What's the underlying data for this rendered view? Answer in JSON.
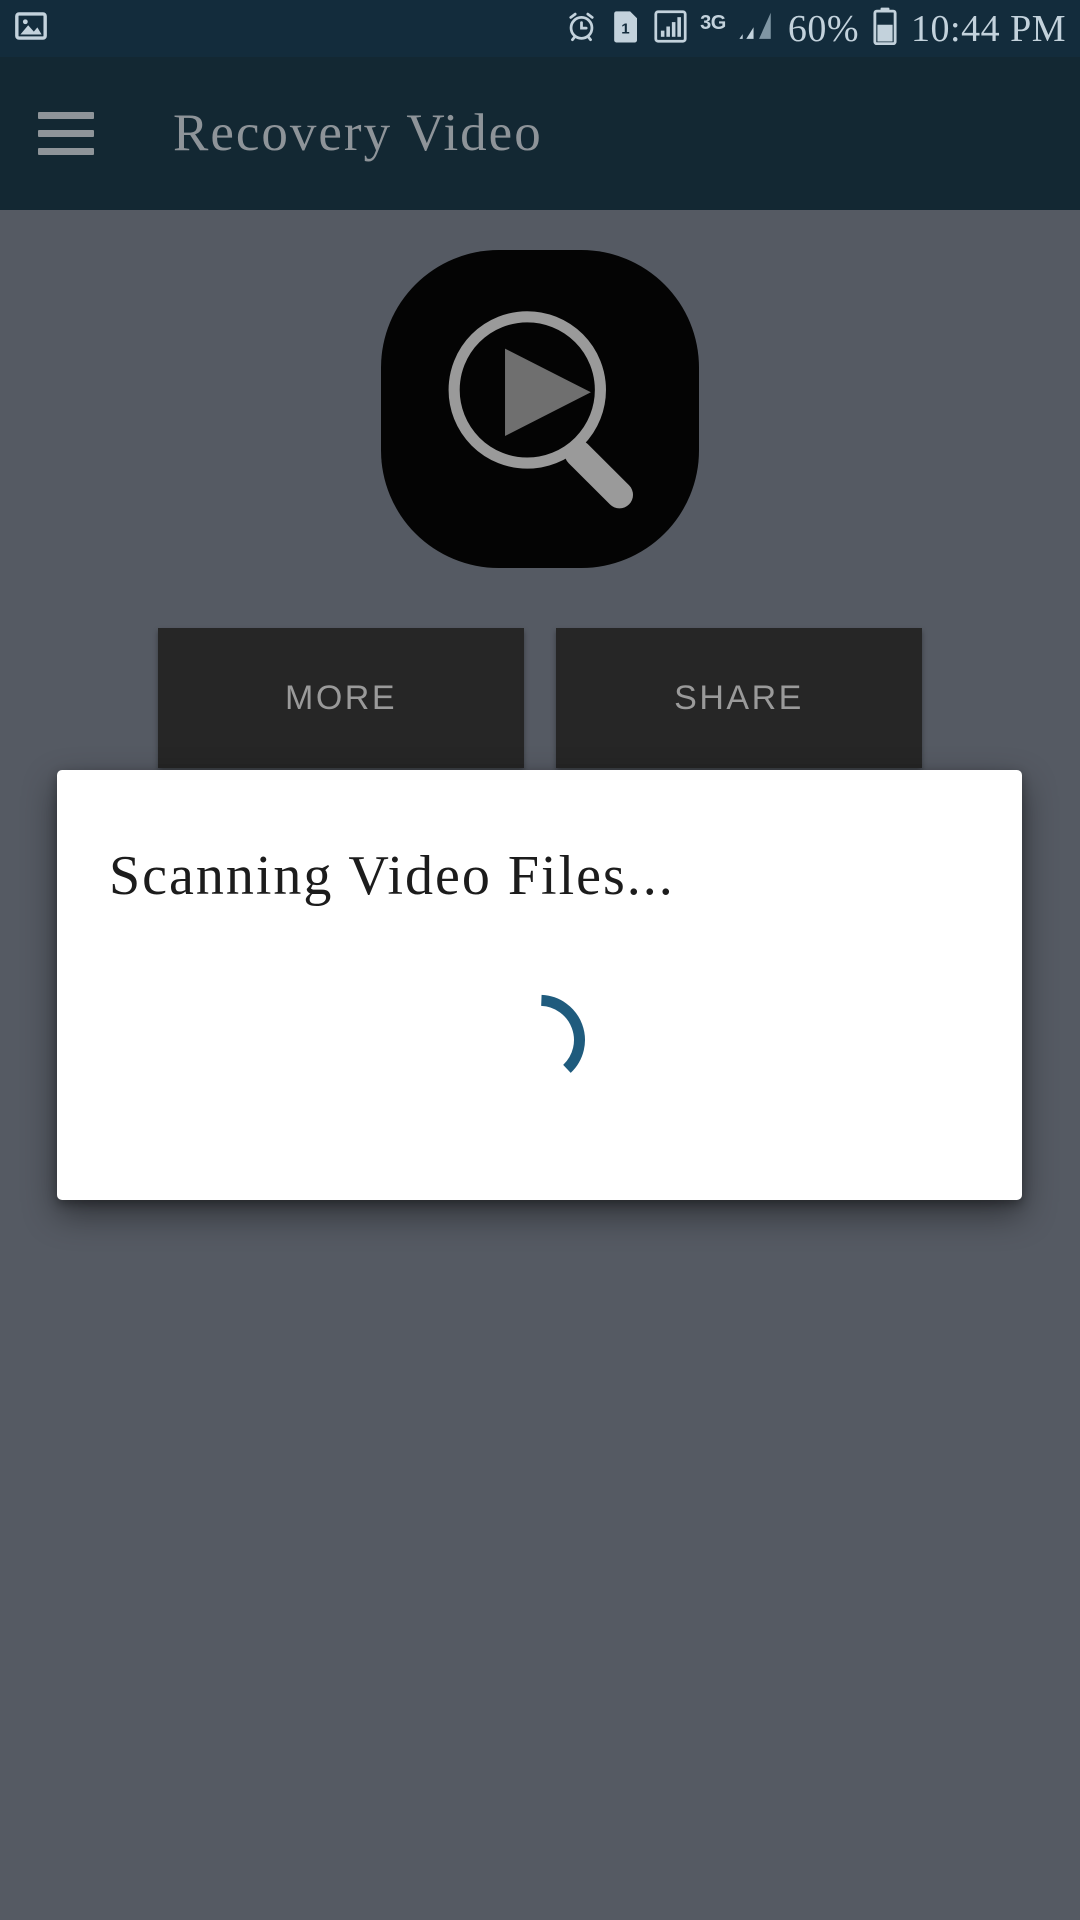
{
  "status_bar": {
    "background_color": "#132c3c",
    "text_color": "#c3d2dc",
    "left_icons": [
      {
        "name": "image-icon",
        "label": "Image"
      }
    ],
    "right_icons": [
      {
        "name": "alarm-icon",
        "label": "Alarm"
      },
      {
        "name": "sim-card-1-icon",
        "label": "SIM 1"
      },
      {
        "name": "signal-bars-icon",
        "label": "Signal"
      }
    ],
    "network_type": "3G",
    "second_signal": "signal-bars-icon",
    "battery_percent": "60%",
    "battery_level": 60,
    "time": "10:44 PM"
  },
  "app_bar": {
    "background_color": "#132833",
    "menu_icon": "hamburger-menu-icon",
    "title": "Recovery Video",
    "title_color": "#8e9499"
  },
  "main": {
    "background_color": "#555a63",
    "logo": {
      "name": "video-search-logo",
      "description": "magnifier with play button",
      "background_color": "#040404",
      "glyph_color": "#7d7d7d"
    },
    "buttons": [
      {
        "name": "more-button",
        "label": "MORE"
      },
      {
        "name": "share-button",
        "label": "SHARE"
      }
    ],
    "button_background": "#262626",
    "button_text_color": "#9a9a9a"
  },
  "dialog": {
    "title": "Scanning Video Files...",
    "title_color": "#1c1c1c",
    "background_color": "#ffffff",
    "spinner": {
      "name": "loading-spinner",
      "color": "#1f5b7d",
      "progress_arc_degrees": 90
    }
  }
}
